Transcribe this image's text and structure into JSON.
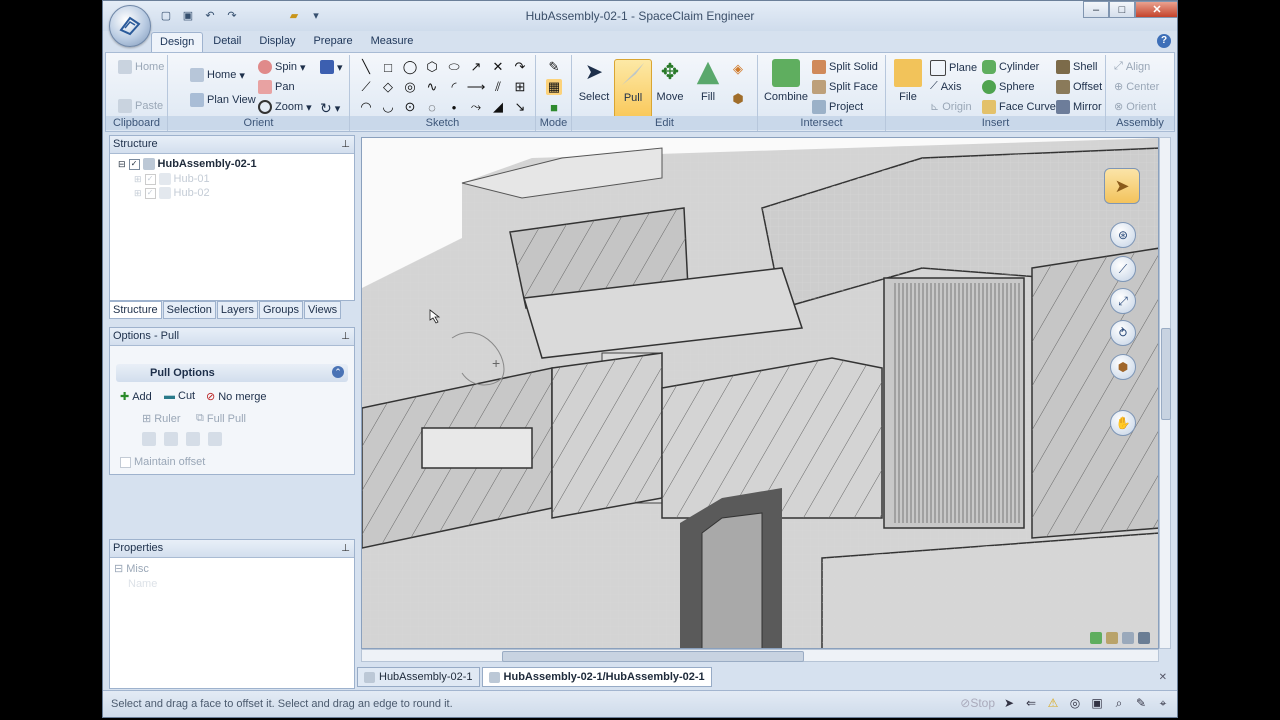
{
  "window": {
    "title": "HubAssembly-02-1 - SpaceClaim Engineer"
  },
  "ribbon_tabs": [
    "Design",
    "Detail",
    "Display",
    "Prepare",
    "Measure"
  ],
  "clipboard": {
    "label": "Clipboard",
    "home": "Home",
    "paste": "Paste"
  },
  "orient": {
    "label": "Orient",
    "home": "Home",
    "plan_view": "Plan View",
    "spin": "Spin",
    "pan": "Pan",
    "zoom": "Zoom"
  },
  "sketch": {
    "label": "Sketch"
  },
  "mode": {
    "label": "Mode"
  },
  "edit": {
    "label": "Edit",
    "select": "Select",
    "pull": "Pull",
    "move": "Move",
    "fill": "Fill"
  },
  "intersect": {
    "label": "Intersect",
    "combine": "Combine",
    "split_solid": "Split Solid",
    "split_face": "Split Face",
    "project": "Project"
  },
  "insert": {
    "label": "Insert",
    "file": "File",
    "plane": "Plane",
    "axis": "Axis",
    "origin": "Origin",
    "cylinder": "Cylinder",
    "sphere": "Sphere",
    "face_curve": "Face Curve",
    "shell": "Shell",
    "offset": "Offset",
    "mirror": "Mirror"
  },
  "assembly": {
    "label": "Assembly",
    "align": "Align",
    "center": "Center",
    "orient": "Orient"
  },
  "structure": {
    "header": "Structure",
    "root": "HubAssembly-02-1",
    "children": [
      "Hub-01",
      "Hub-02"
    ]
  },
  "panel_tabs": [
    "Structure",
    "Selection",
    "Layers",
    "Groups",
    "Views"
  ],
  "options": {
    "header": "Options - Pull",
    "pull_options": "Pull Options",
    "add": "Add",
    "cut": "Cut",
    "no_merge": "No merge",
    "ruler": "Ruler",
    "full_pull": "Full Pull",
    "maintain_offset": "Maintain offset"
  },
  "properties": {
    "header": "Properties",
    "misc": "Misc",
    "misc_row": "Name"
  },
  "doc_tabs": [
    "HubAssembly-02-1",
    "HubAssembly-02-1/HubAssembly-02-1"
  ],
  "status": {
    "text": "Select and drag a face to offset it. Select and drag an edge to round it.",
    "stop": "Stop"
  }
}
